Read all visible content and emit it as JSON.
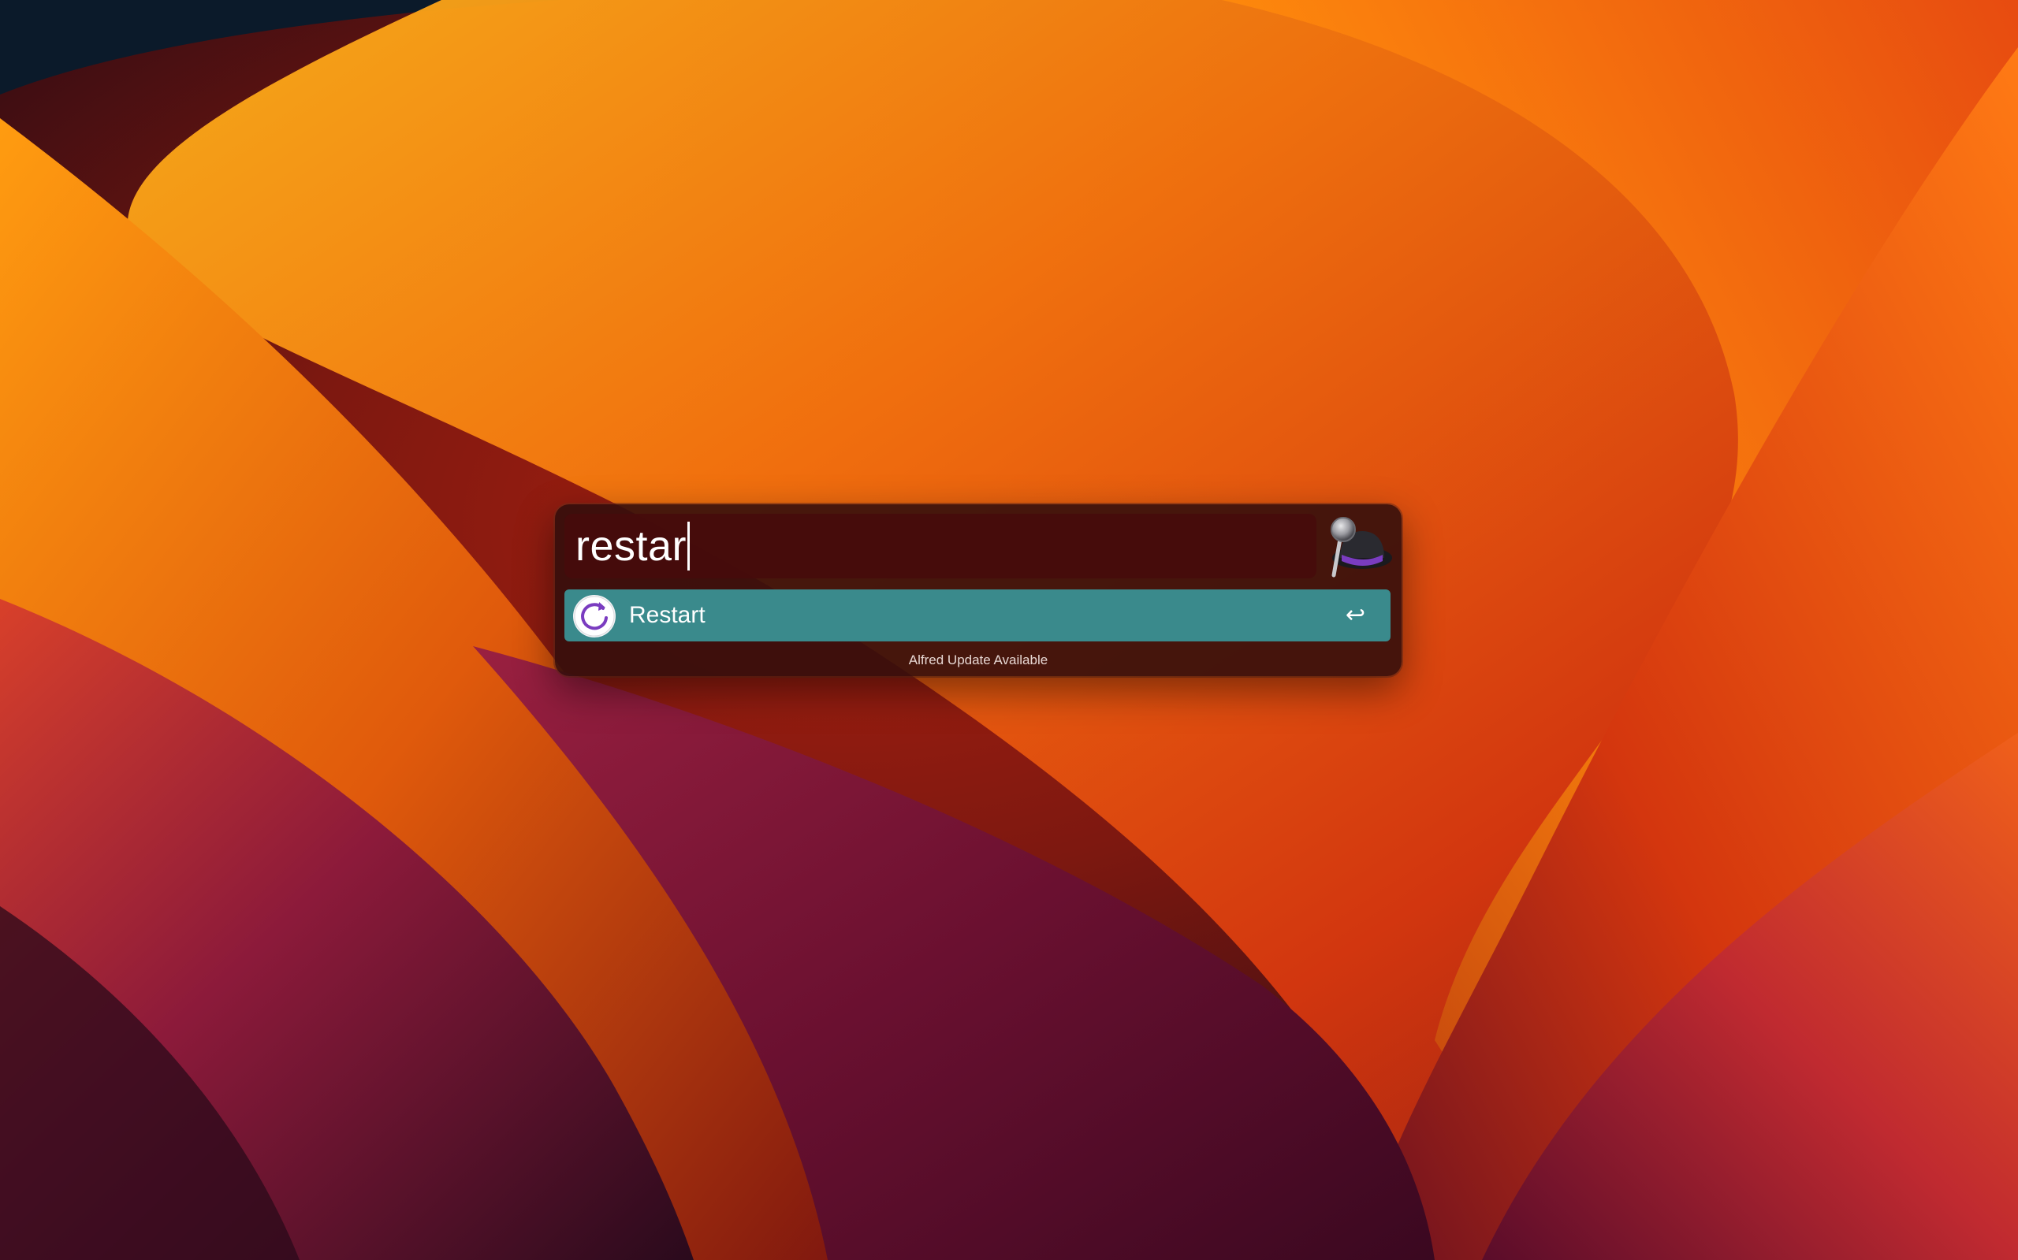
{
  "search": {
    "value": "restar"
  },
  "results": [
    {
      "title": "Restart",
      "icon": "restart-icon",
      "action_icon": "return-key-icon",
      "action_glyph": "↩",
      "selected": true
    }
  ],
  "footer": {
    "text": "Alfred Update Available"
  },
  "colors": {
    "selection": "#3a8a8c",
    "window_bg": "#340e0c",
    "wallpaper_orange": "#f07a10",
    "wallpaper_red": "#c42a12",
    "wallpaper_magenta": "#7a1240",
    "wallpaper_navy": "#0b1a2a"
  },
  "logo": {
    "icon": "alfred-hat-icon"
  }
}
